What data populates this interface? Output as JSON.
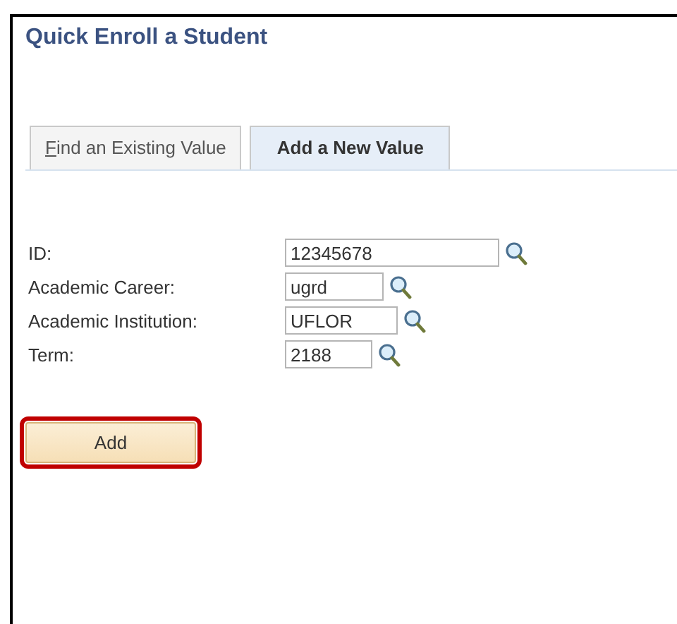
{
  "page_title": "Quick Enroll a Student",
  "tabs": [
    {
      "label": "Find an Existing Value",
      "selected": false
    },
    {
      "label": "Add a New Value",
      "selected": true
    }
  ],
  "fields": [
    {
      "label": "ID:",
      "value": "12345678"
    },
    {
      "label": "Academic Career:",
      "value": "ugrd"
    },
    {
      "label": "Academic Institution:",
      "value": "UFLOR"
    },
    {
      "label": "Term:",
      "value": "2188"
    }
  ],
  "add_button": {
    "label": "Add",
    "highlighted": true
  }
}
